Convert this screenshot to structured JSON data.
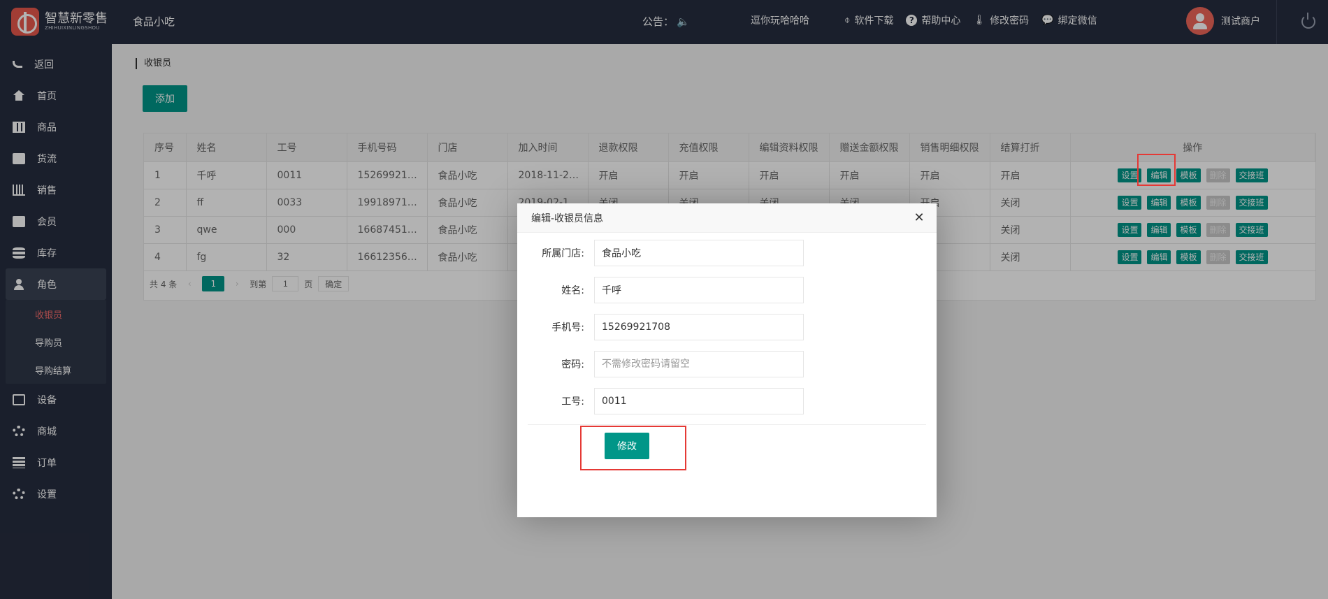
{
  "brand": {
    "name_cn": "智慧新零售",
    "name_en": "ZHIHUIXINLINGSHOU"
  },
  "header": {
    "store": "食品小吃",
    "notice_label": "公告：",
    "notice_text": "逗你玩哈哈哈",
    "links": [
      {
        "label": "软件下载",
        "icon": "download-icon"
      },
      {
        "label": "帮助中心",
        "icon": "help-icon"
      },
      {
        "label": "修改密码",
        "icon": "thermometer-icon"
      },
      {
        "label": "绑定微信",
        "icon": "chat-icon"
      }
    ],
    "user": "测试商户"
  },
  "sidebar": {
    "items": [
      {
        "label": "返回",
        "icon": "back-icon"
      },
      {
        "label": "首页",
        "icon": "home-icon"
      },
      {
        "label": "商品",
        "icon": "grid-icon"
      },
      {
        "label": "货流",
        "icon": "truck-icon"
      },
      {
        "label": "销售",
        "icon": "bar-chart-icon"
      },
      {
        "label": "会员",
        "icon": "member-card-icon"
      },
      {
        "label": "库存",
        "icon": "database-icon"
      },
      {
        "label": "角色",
        "icon": "user-icon"
      },
      {
        "label": "设备",
        "icon": "printer-icon"
      },
      {
        "label": "商城",
        "icon": "gear-icon"
      },
      {
        "label": "订单",
        "icon": "list-icon"
      },
      {
        "label": "设置",
        "icon": "gear-icon"
      }
    ],
    "sub_items": [
      {
        "label": "收银员"
      },
      {
        "label": "导购员"
      },
      {
        "label": "导购结算"
      }
    ]
  },
  "page": {
    "breadcrumb": "收银员",
    "add_button": "添加"
  },
  "table": {
    "headers": [
      "序号",
      "姓名",
      "工号",
      "手机号码",
      "门店",
      "加入时间",
      "退款权限",
      "充值权限",
      "编辑资料权限",
      "赠送金额权限",
      "销售明细权限",
      "结算打折",
      "操作"
    ],
    "rows": [
      [
        "1",
        "千呼",
        "0011",
        "15269921…",
        "食品小吃",
        "2018-11-2…",
        "开启",
        "开启",
        "开启",
        "开启",
        "开启",
        "开启"
      ],
      [
        "2",
        "ff",
        "0033",
        "19918971…",
        "食品小吃",
        "2019-02-1…",
        "关闭",
        "关闭",
        "关闭",
        "关闭",
        "开启",
        "关闭"
      ],
      [
        "3",
        "qwe",
        "000",
        "16687451…",
        "食品小吃",
        "",
        "",
        "",
        "",
        "",
        "",
        "关闭"
      ],
      [
        "4",
        "fg",
        "32",
        "16612356…",
        "食品小吃",
        "",
        "",
        "",
        "",
        "",
        "",
        "关闭"
      ]
    ],
    "actions": [
      "设置",
      "编辑",
      "模板",
      "删除",
      "交接班"
    ]
  },
  "pagination": {
    "total": "共 4 条",
    "current": "1",
    "goto_label": "到第",
    "goto_value": "1",
    "page_unit": "页",
    "confirm": "确定"
  },
  "dialog": {
    "title": "编辑-收银员信息",
    "fields": [
      {
        "label": "所属门店:",
        "value": "食品小吃",
        "placeholder": ""
      },
      {
        "label": "姓名:",
        "value": "千呼",
        "placeholder": ""
      },
      {
        "label": "手机号:",
        "value": "15269921708",
        "placeholder": ""
      },
      {
        "label": "密码:",
        "value": "",
        "placeholder": "不需修改密码请留空"
      },
      {
        "label": "工号:",
        "value": "0011",
        "placeholder": ""
      }
    ],
    "submit": "修改"
  }
}
